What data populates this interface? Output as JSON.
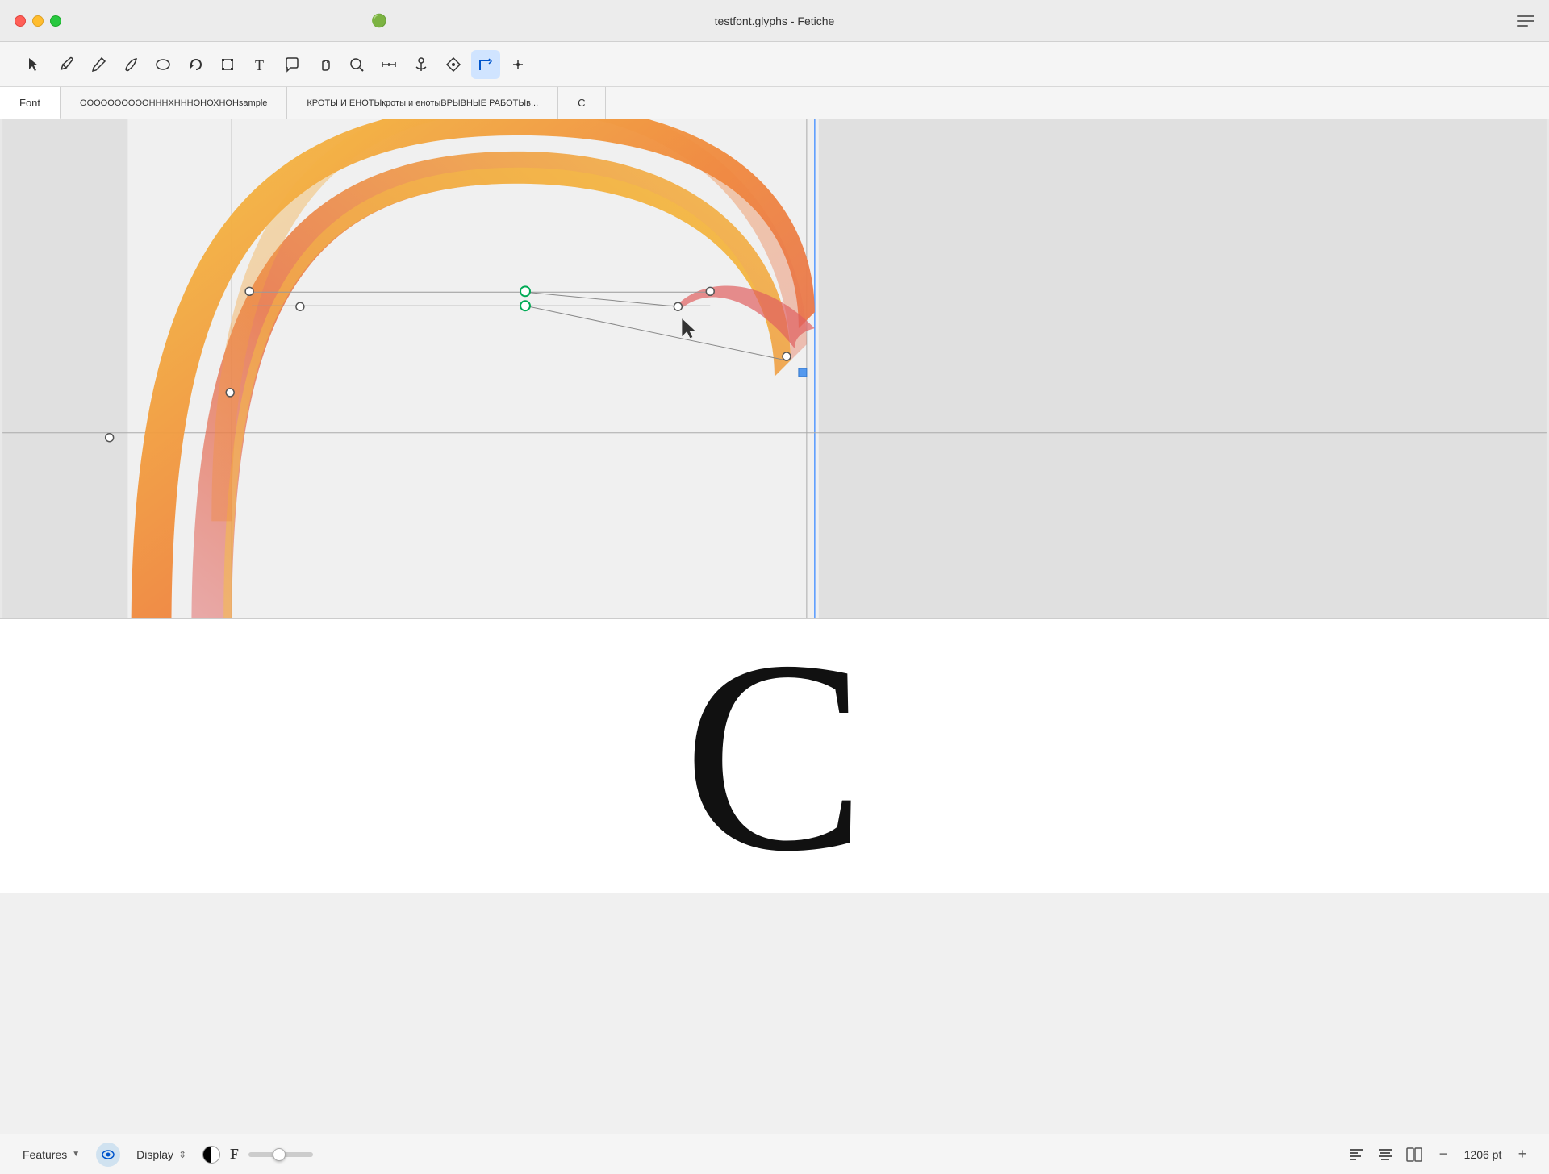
{
  "app": {
    "title": "testfont.glyphs - Fetiche",
    "icon": "🟢"
  },
  "traffic_lights": {
    "red_label": "close",
    "yellow_label": "minimize",
    "green_label": "maximize"
  },
  "toolbar": {
    "tools": [
      {
        "id": "select",
        "symbol": "↖",
        "label": "Select Tool",
        "active": false
      },
      {
        "id": "pen",
        "symbol": "✒",
        "label": "Pen Tool",
        "active": false
      },
      {
        "id": "pencil",
        "symbol": "✏",
        "label": "Pencil Tool",
        "active": false
      },
      {
        "id": "brush",
        "symbol": "🖌",
        "label": "Brush Tool",
        "active": false
      },
      {
        "id": "ellipse",
        "symbol": "○",
        "label": "Ellipse Tool",
        "active": false
      },
      {
        "id": "undo",
        "symbol": "↩",
        "label": "Undo",
        "active": false
      },
      {
        "id": "transform",
        "symbol": "⊡",
        "label": "Transform Tool",
        "active": false
      },
      {
        "id": "text",
        "symbol": "T",
        "label": "Text Tool",
        "active": false
      },
      {
        "id": "speech",
        "symbol": "💬",
        "label": "Speech",
        "active": false
      },
      {
        "id": "hand",
        "symbol": "✋",
        "label": "Hand Tool",
        "active": false
      },
      {
        "id": "zoom",
        "symbol": "⌕",
        "label": "Zoom Tool",
        "active": false
      },
      {
        "id": "measure",
        "symbol": "⟷",
        "label": "Measure Tool",
        "active": false
      },
      {
        "id": "anchor",
        "symbol": "⊙",
        "label": "Anchor Tool",
        "active": false
      },
      {
        "id": "shape",
        "symbol": "◈",
        "label": "Shape Tool",
        "active": false
      },
      {
        "id": "corner",
        "symbol": "⌐",
        "label": "Corner Tool",
        "active": true
      },
      {
        "id": "node",
        "symbol": "⊤",
        "label": "Node Tool",
        "active": false
      }
    ]
  },
  "tabs": [
    {
      "id": "font",
      "label": "Font",
      "active": true
    },
    {
      "id": "tab2",
      "label": "ООООООООООНННХНННОНОХНОНsample",
      "active": false
    },
    {
      "id": "tab3",
      "label": "КРОТЫ И ЕНОТЫкроты и енотыВРЫВНЫЕ РАБОТЫв...",
      "active": false
    },
    {
      "id": "tab4",
      "label": "C",
      "active": false
    }
  ],
  "preview": {
    "glyph": "C"
  },
  "bottom_bar": {
    "features_label": "Features",
    "display_label": "Display",
    "zoom_value": "1206 pt",
    "zoom_minus": "−",
    "zoom_plus": "+"
  },
  "canvas": {
    "background": "#e8e8e8"
  }
}
